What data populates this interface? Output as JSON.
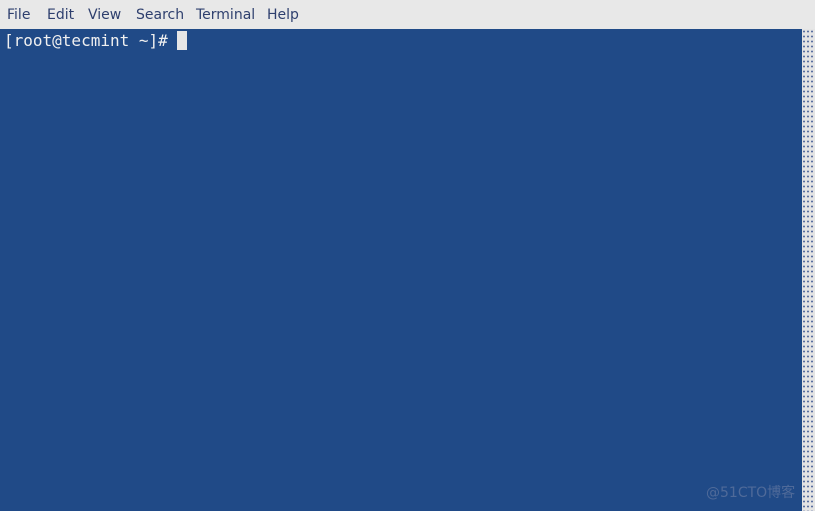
{
  "menubar": {
    "items": [
      "File",
      "Edit",
      "View",
      "Search",
      "Terminal",
      "Help"
    ]
  },
  "terminal": {
    "prompt": "[root@tecmint ~]#",
    "background_color": "#204a87",
    "text_color": "#f0f0f0"
  },
  "watermark": "@51CTO博客"
}
